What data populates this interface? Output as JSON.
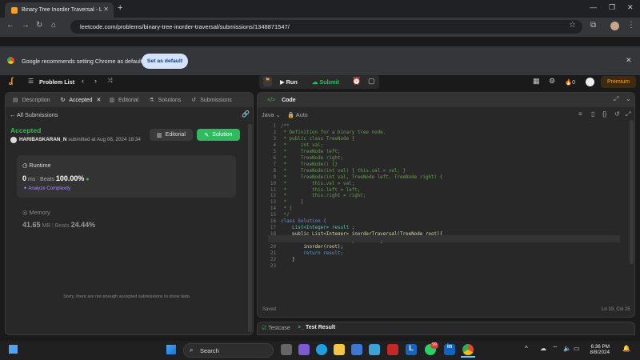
{
  "browser": {
    "tab_title": "Binary Tree Inorder Traversal - L",
    "url": "leetcode.com/problems/binary-tree-inorder-traversal/submissions/1348871547/",
    "infobar_message": "Google recommends setting Chrome as default",
    "set_default_label": "Set as default"
  },
  "header": {
    "problem_list": "Problem List",
    "run": "Run",
    "submit": "Submit",
    "fire_count": "0",
    "premium": "Premium"
  },
  "left_tabs": {
    "description": "Description",
    "accepted": "Accepted",
    "editorial": "Editorial",
    "solutions": "Solutions",
    "submissions": "Submissions"
  },
  "submission": {
    "back_label": "All Submissions",
    "status": "Accepted",
    "user": "HARIBASKARAN_N",
    "submitted_at": "submitted at Aug 08, 2024 18:34",
    "editorial_btn": "Editorial",
    "solution_btn": "Solution",
    "runtime_label": "Runtime",
    "runtime_value": "0",
    "runtime_unit": "ms",
    "beats_label": "Beats",
    "runtime_beats": "100.00%",
    "analyze": "Analyze Complexity",
    "memory_label": "Memory",
    "memory_value": "41.65",
    "memory_unit": "MB",
    "memory_beats": "24.44%",
    "no_data_msg": "Sorry, there are not enough accepted submissions to show data"
  },
  "editor": {
    "title": "Code",
    "language": "Java",
    "mode": "Auto",
    "saved": "Saved",
    "position": "Ln 19, Col 25",
    "lines": [
      {
        "n": "1",
        "t": "/**",
        "c": "cmt"
      },
      {
        "n": "2",
        "t": " * Definition for a binary tree node.",
        "c": "cmt"
      },
      {
        "n": "3",
        "t": " * public class TreeNode {",
        "c": "cmt"
      },
      {
        "n": "4",
        "t": " *     int val;",
        "c": "cmt"
      },
      {
        "n": "5",
        "t": " *     TreeNode left;",
        "c": "cmt"
      },
      {
        "n": "6",
        "t": " *     TreeNode right;",
        "c": "cmt"
      },
      {
        "n": "7",
        "t": " *     TreeNode() {}",
        "c": "cmt"
      },
      {
        "n": "8",
        "t": " *     TreeNode(int val) { this.val = val; }",
        "c": "cmt"
      },
      {
        "n": "9",
        "t": " *     TreeNode(int val, TreeNode left, TreeNode right) {",
        "c": "cmt"
      },
      {
        "n": "10",
        "t": " *         this.val = val;",
        "c": "cmt"
      },
      {
        "n": "11",
        "t": " *         this.left = left;",
        "c": "cmt"
      },
      {
        "n": "12",
        "t": " *         this.right = right;",
        "c": "cmt"
      },
      {
        "n": "13",
        "t": " *     }",
        "c": "cmt"
      },
      {
        "n": "14",
        "t": " * }",
        "c": "cmt"
      },
      {
        "n": "15",
        "t": " */",
        "c": "cmt"
      },
      {
        "n": "16",
        "t": "class Solution {",
        "c": "kw"
      },
      {
        "n": "17",
        "t": "    List<Integer> result ;",
        "c": "ty"
      },
      {
        "n": "18",
        "t": "    public List<Integer> inorderTraversal(TreeNode root){",
        "c": "fn"
      },
      {
        "n": "19",
        "t": "        result = new ArrayList<Integer>();",
        "c": "vr"
      },
      {
        "n": "20",
        "t": "        inorder(root);",
        "c": "fn"
      },
      {
        "n": "21",
        "t": "        return result;",
        "c": "kw"
      },
      {
        "n": "22",
        "t": "    }",
        "c": ""
      },
      {
        "n": "23",
        "t": "",
        "c": ""
      }
    ]
  },
  "bottom_tabs": {
    "testcase": "Testcase",
    "test_result": "Test Result"
  },
  "taskbar": {
    "search": "Search",
    "time": "6:36 PM",
    "date": "8/8/2024",
    "badge": "99"
  }
}
